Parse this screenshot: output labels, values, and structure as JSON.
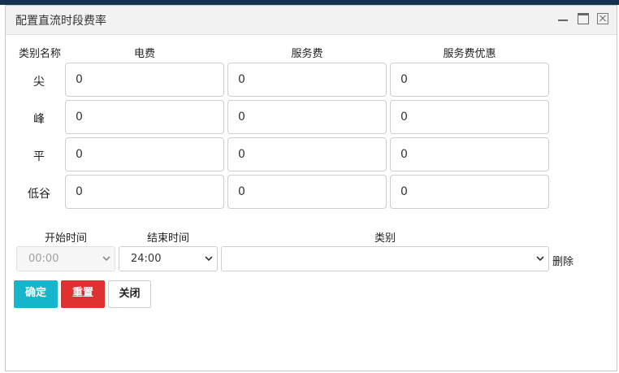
{
  "window": {
    "title": "配置直流时段费率"
  },
  "columns": {
    "category_name": "类别名称",
    "electricity": "电费",
    "service": "服务费",
    "service_discount": "服务费优惠"
  },
  "rate_rows": [
    {
      "label": "尖",
      "electricity": "0",
      "service": "0",
      "service_discount": "0"
    },
    {
      "label": "峰",
      "electricity": "0",
      "service": "0",
      "service_discount": "0"
    },
    {
      "label": "平",
      "electricity": "0",
      "service": "0",
      "service_discount": "0"
    },
    {
      "label": "低谷",
      "electricity": "0",
      "service": "0",
      "service_discount": "0"
    }
  ],
  "period": {
    "start_label": "开始时间",
    "end_label": "结束时间",
    "type_label": "类别",
    "start_value": "00:00",
    "end_value": "24:00",
    "type_value": "",
    "delete_label": "删除"
  },
  "actions": {
    "confirm": "确定",
    "reset": "重置",
    "close": "关闭"
  },
  "colors": {
    "confirm": "#17b5cc",
    "reset": "#e03131",
    "title_bar": "#f2f2f2",
    "top_band": "#16314f"
  }
}
